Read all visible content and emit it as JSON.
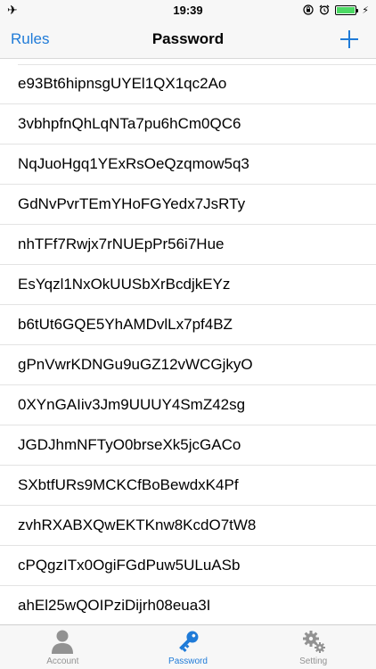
{
  "status_bar": {
    "time": "19:39",
    "left_icon": "airplane-icon",
    "right_icons": [
      "rotation-lock-icon",
      "alarm-icon",
      "battery-icon",
      "charging-icon"
    ],
    "battery_color": "#4cd964"
  },
  "nav_bar": {
    "left_label": "Rules",
    "title": "Password",
    "right_icon": "plus-icon",
    "accent_color": "#1f7bd8"
  },
  "passwords": [
    "e93Bt6hipnsgUYEl1QX1qc2Ao",
    "3vbhpfnQhLqNTa7pu6hCm0QC6",
    "NqJuoHgq1YExRsOeQzqmow5q3",
    "GdNvPvrTEmYHoFGYedx7JsRTy",
    "nhTFf7Rwjx7rNUEpPr56i7Hue",
    "EsYqzl1NxOkUUSbXrBcdjkEYz",
    "b6tUt6GQE5YhAMDvlLx7pf4BZ",
    "gPnVwrKDNGu9uGZ12vWCGjkyO",
    "0XYnGAIiv3Jm9UUUY4SmZ42sg",
    "JGDJhmNFTyO0brseXk5jcGACo",
    "SXbtfURs9MCKCfBoBewdxK4Pf",
    "zvhRXABXQwEKTKnw8KcdO7tW8",
    "cPQgzITx0OgiFGdPuw5ULuASb",
    "ahEl25wQOIPziDijrh08eua3I"
  ],
  "tab_bar": {
    "tabs": [
      {
        "label": "Account",
        "icon": "person-icon",
        "active": false
      },
      {
        "label": "Password",
        "icon": "key-icon",
        "active": true
      },
      {
        "label": "Setting",
        "icon": "gears-icon",
        "active": false
      }
    ]
  }
}
